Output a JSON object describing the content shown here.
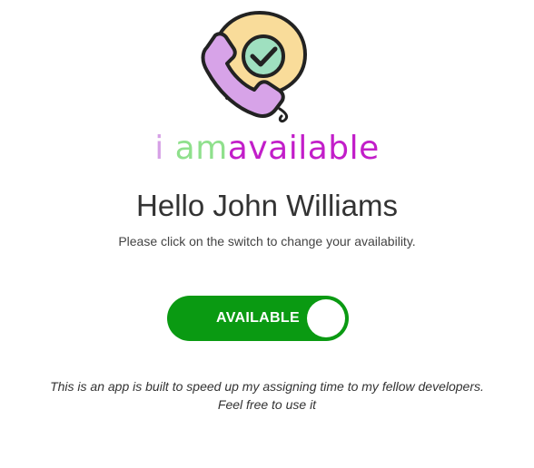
{
  "logo": {
    "icon": "phone-checkmark-icon",
    "text_part1": "i ",
    "text_part2": "am",
    "text_part3": "available",
    "colors": {
      "part1": "#d6a0e6",
      "part2": "#8fe08c",
      "part3": "#c21ec9",
      "bubble": "#f9dc9a",
      "check_circle": "#9fe0c0",
      "phone": "#d7a3e8"
    }
  },
  "greeting": {
    "title": "Hello John Williams",
    "subtitle": "Please click on the switch to change your availability."
  },
  "availability_toggle": {
    "label": "AVAILABLE",
    "state": "on",
    "color": "#0a9a12"
  },
  "footer": {
    "line1": "This is an app is built to speed up my assigning time to my fellow developers.",
    "line2": "Feel free to use it"
  }
}
